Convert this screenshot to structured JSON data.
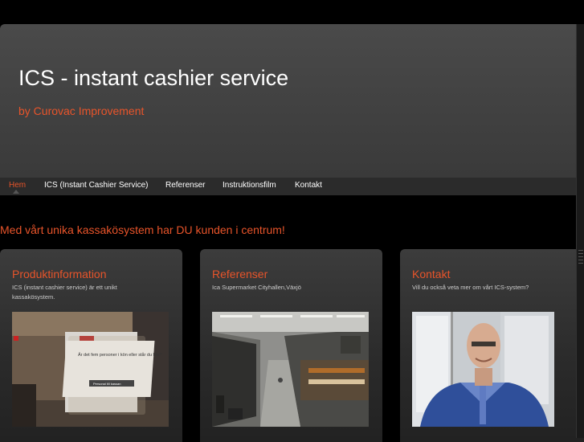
{
  "header": {
    "title": "ICS - instant cashier service",
    "subtitle": "by Curovac Improvement"
  },
  "nav": {
    "items": [
      {
        "label": "Hem",
        "active": true
      },
      {
        "label": "ICS (Instant Cashier Service)",
        "active": false
      },
      {
        "label": "Referenser",
        "active": false
      },
      {
        "label": "Instruktionsfilm",
        "active": false
      },
      {
        "label": "Kontakt",
        "active": false
      }
    ]
  },
  "tagline": "Med vårt unika kassakösystem har DU kunden i centrum!",
  "cards": [
    {
      "title": "Produktinformation",
      "text": "ICS (instant cashier service) är ett unikt kassakösystem.",
      "image": {
        "screen_text": "Är det fem personer i kön eller står du här?",
        "button_text": "Personal till kassan"
      }
    },
    {
      "title": "Referenser",
      "text": "Ica Supermarket Cityhallen,Växjö"
    },
    {
      "title": "Kontakt",
      "text": "Vill du också veta mer om vårt ICS-system?"
    }
  ],
  "colors": {
    "accent": "#e8542a",
    "background": "#000000",
    "header": "#444444"
  }
}
